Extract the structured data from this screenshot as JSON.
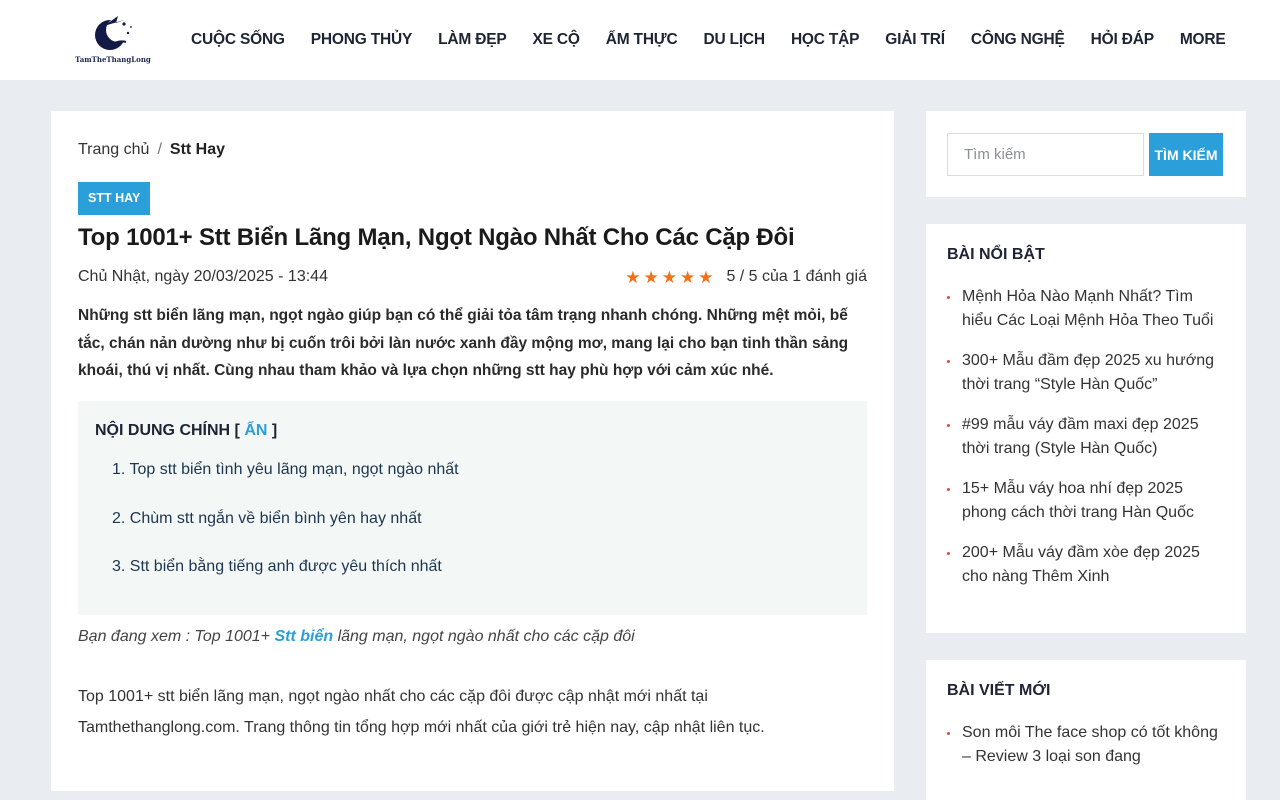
{
  "site": {
    "logo_text": "TamTheThangLong",
    "nav": [
      "CUỘC SỐNG",
      "PHONG THỦY",
      "LÀM ĐẸP",
      "XE CỘ",
      "ẨM THỰC",
      "DU LỊCH",
      "HỌC TẬP",
      "GIẢI TRÍ",
      "CÔNG NGHỆ",
      "HỎI ĐÁP",
      "MORE"
    ]
  },
  "breadcrumb": {
    "home": "Trang chủ",
    "separator": "/",
    "current": "Stt Hay"
  },
  "article": {
    "category": "STT HAY",
    "title": "Top 1001+ Stt Biển Lãng Mạn, Ngọt Ngào Nhất Cho Các Cặp Đôi",
    "date": "Chủ Nhật, ngày 20/03/2025 - 13:44",
    "rating_text": "5 / 5 của 1 đánh giá",
    "rating_value": 5,
    "rating_max": 5,
    "intro": "Những stt biển  lãng mạn, ngọt ngào giúp bạn có thể giải tỏa tâm trạng nhanh chóng. Những mệt mỏi, bế tắc, chán nản dường như bị cuốn trôi bởi làn nước xanh đầy mộng mơ, mang lại cho bạn tinh thần sảng khoái, thú vị nhất. Cùng nhau tham khảo và lựa chọn những stt hay phù hợp với cảm xúc nhé.",
    "toc": {
      "heading_prefix": "NỘI DUNG CHÍNH [ ",
      "toggle": "ẨN",
      "heading_suffix": " ]",
      "items": [
        "1. Top stt biển tình yêu lãng mạn, ngọt ngào nhất",
        "2. Chùm stt ngắn về biển bình yên hay nhất",
        "3. Stt biển bằng tiếng anh được yêu thích nhất"
      ]
    },
    "viewing_prefix": "Bạn đang xem : Top 1001+ ",
    "viewing_link": "Stt biển",
    "viewing_suffix": " lãng mạn, ngọt ngào nhất cho các cặp đôi",
    "body": "Top 1001+ stt biển lãng mạn, ngọt ngào nhất cho các cặp đôi được cập nhật mới nhất tại Tamthethanglong.com. Trang thông tin tổng hợp mới nhất của giới trẻ hiện nay, cập nhật liên tục."
  },
  "sidebar": {
    "search_placeholder": "Tìm kiếm",
    "search_button": "TÌM KIẾM",
    "featured_heading": "BÀI NỔI BẬT",
    "featured": [
      "Mệnh Hỏa Nào Mạnh Nhất? Tìm hiểu Các Loại Mệnh Hỏa Theo Tuổi",
      "300+ Mẫu đầm đẹp 2025 xu hướng thời trang “Style Hàn Quốc”",
      "#99 mẫu váy đầm maxi đẹp 2025 thời trang (Style Hàn Quốc)",
      "15+ Mẫu váy hoa nhí đẹp 2025 phong cách thời trang Hàn Quốc",
      "200+ Mẫu váy đầm xòe đẹp 2025 cho nàng Thêm Xinh"
    ],
    "recent_heading": "BÀI VIẾT MỚI",
    "recent": [
      "Son môi The face shop có tốt không – Review 3 loại son đang"
    ]
  },
  "colors": {
    "accent": "#2b9fd9",
    "star": "#f2711c",
    "background": "#e9edf1"
  }
}
